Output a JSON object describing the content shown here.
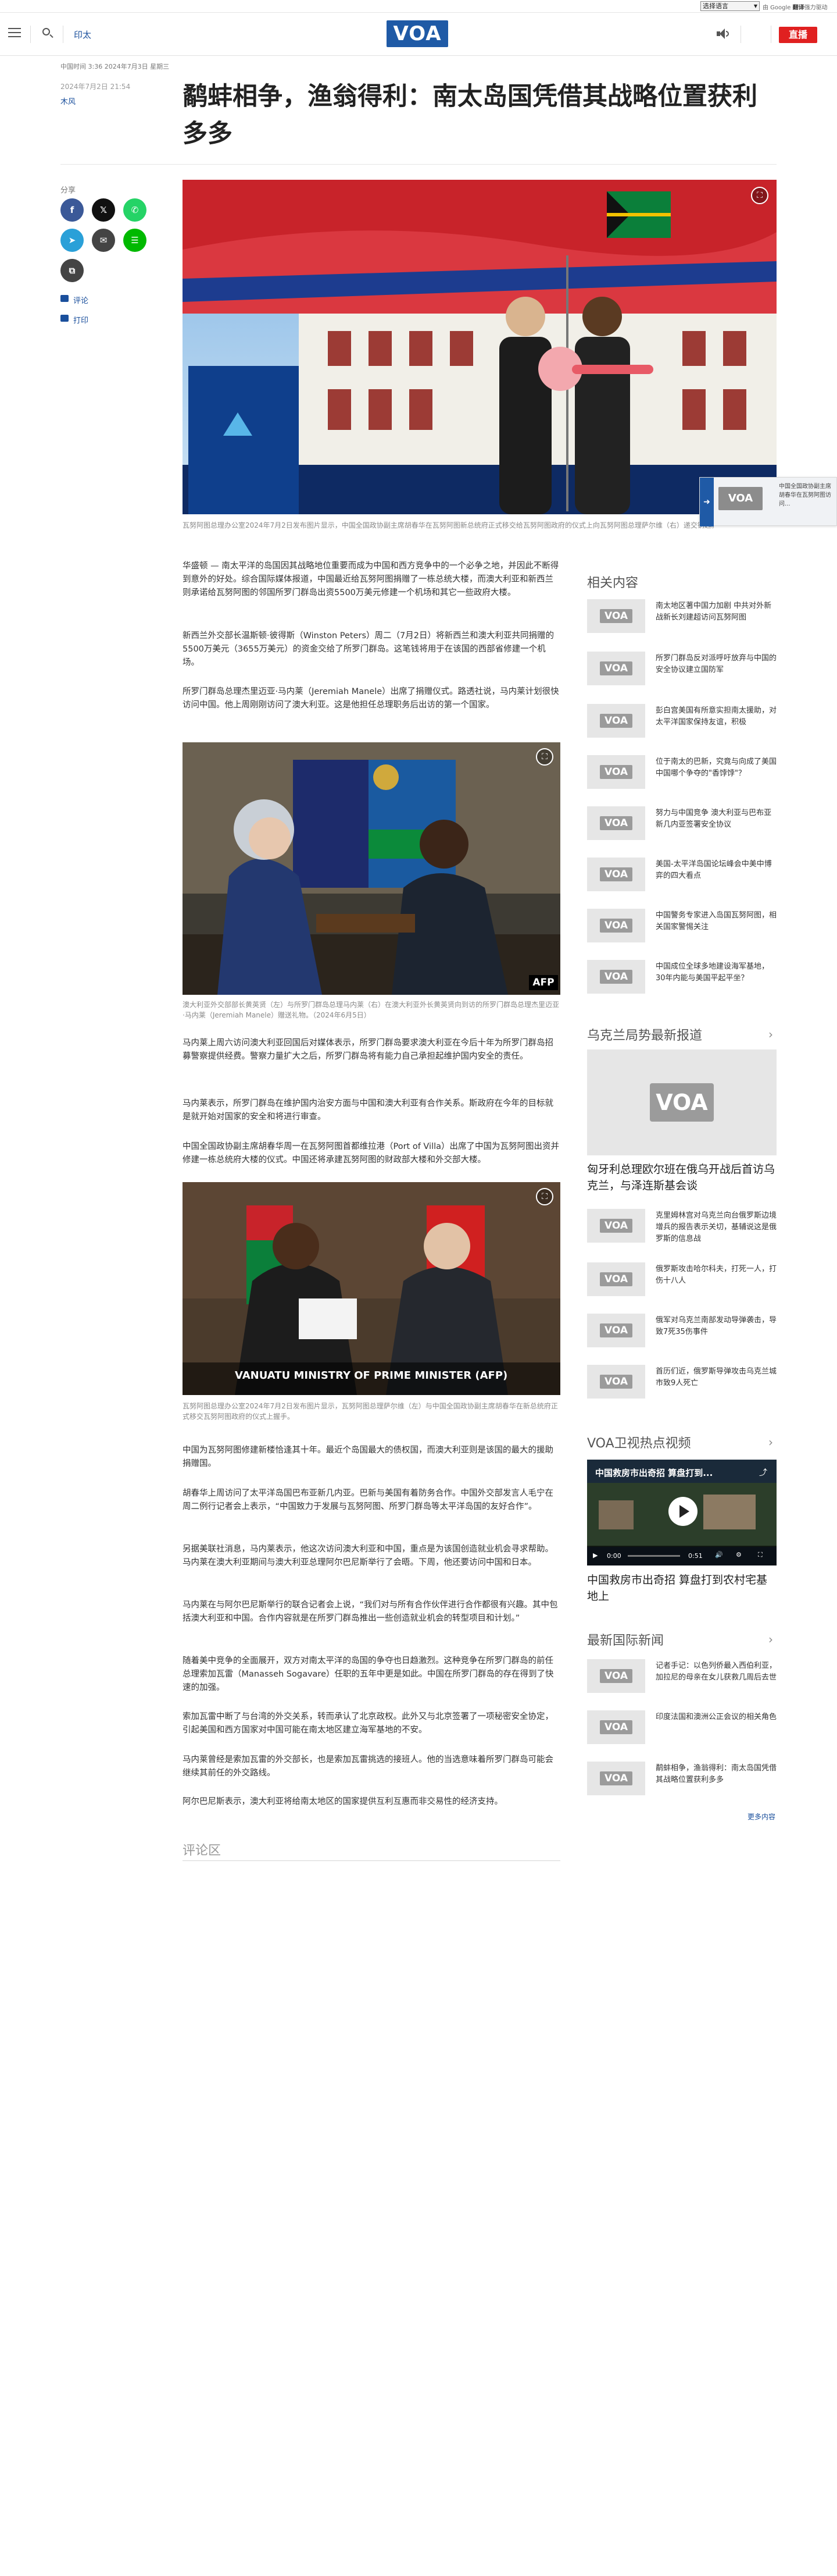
{
  "translate": {
    "select_label": "选择语言",
    "credit_prefix": "由 Google",
    "credit_brand": "翻译",
    "credit_suffix": "强力驱动"
  },
  "header": {
    "region": "印太",
    "logo_text": "VOA",
    "live_label": "直播"
  },
  "meta": {
    "timeline": "中国时间 3:36 2024年7月3日 星期三",
    "pubdate": "2024年7月2日 21:54",
    "author": "木风"
  },
  "article": {
    "title": "鹬蚌相争，渔翁得利：南太岛国凭借其战略位置获利多多",
    "share_label": "分享",
    "comments_link": "评论",
    "print_link": "打印",
    "hero_caption": "瓦努阿图总理办公室2024年7月2日发布图片显示，中国全国政协副主席胡春华在瓦努阿图新总统府正式移交给瓦努阿图政府的仪式上向瓦努阿图总理萨尔维（右）递交钥匙。",
    "paragraphs1": [
      "华盛顿 — 南太平洋的岛国因其战略地位重要而成为中国和西方竞争中的一个必争之地，并因此不断得到意外的好处。综合国际媒体报道，中国最近给瓦努阿图捐赠了一栋总统大楼，而澳大利亚和新西兰则承诺给瓦努阿图的邻国所罗门群岛出资5500万美元修建一个机场和其它一些政府大楼。",
      "新西兰外交部长温斯顿·彼得斯（Winston Peters）周二（7月2日）将新西兰和澳大利亚共同捐赠的5500万美元（3655万美元）的资金交给了所罗门群岛。这笔钱将用于在该国的西部省修建一个机场。",
      "所罗门群岛总理杰里迈亚·马内莱（Jeremiah Manele）出席了捐赠仪式。路透社说，马内莱计划很快访问中国。他上周刚刚访问了澳大利亚。这是他担任总理职务后出访的第一个国家。"
    ],
    "img2_caption": "澳大利亚外交部部长黄英贤（左）与所罗门群岛总理马内莱（右）在澳大利亚外长黄英贤向到访的所罗门群岛总理杰里迈亚·马内莱（Jeremiah Manele）赠送礼物。（2024年6月5日）",
    "img2_badge": "AFP",
    "paragraphs2": [
      "马内莱上周六访问澳大利亚回国后对媒体表示，所罗门群岛要求澳大利亚在今后十年为所罗门群岛招募警察提供经费。警察力量扩大之后，所罗门群岛将有能力自己承担起维护国内安全的责任。",
      "马内莱表示，所罗门群岛在维护国内治安方面与中国和澳大利亚有合作关系。斯政府在今年的目标就是就开始对国家的安全和将进行审查。",
      "中国全国政协副主席胡春华周一在瓦努阿图首都维拉港（Port of Villa）出席了中国为瓦努阿图出资并修建一栋总统府大楼的仪式。中国还将承建瓦努阿图的财政部大楼和外交部大楼。"
    ],
    "img3_caption": "瓦努阿图总理办公室2024年7月2日发布图片显示，瓦努阿图总理萨尔维（左）与中国全国政协副主席胡春华在新总统府正式移交瓦努阿图政府的仪式上握手。",
    "img3_banner": "VANUATU MINISTRY OF PRIME MINISTER (AFP)",
    "paragraphs3": [
      "中国为瓦努阿图修建新楼恰逢其十年。最近个岛国最大的债权国，而澳大利亚则是该国的最大的援助捐赠国。",
      "胡春华上周访问了太平洋岛国巴布亚新几内亚。巴新与美国有着防务合作。中国外交部发言人毛宁在周二例行记者会上表示，“中国致力于发展与瓦努阿图、所罗门群岛等太平洋岛国的友好合作”。",
      "另据美联社消息，马内莱表示，他这次访问澳大利亚和中国，重点是为该国创造就业机会寻求帮助。马内莱在澳大利亚期间与澳大利亚总理阿尔巴尼斯举行了会晤。下周，他还要访问中国和日本。",
      "马内莱在与阿尔巴尼斯举行的联合记者会上说，“我们对与所有合作伙伴进行合作都很有兴趣。其中包括澳大利亚和中国。合作内容就是在所罗门群岛推出一些创造就业机会的转型项目和计划。”",
      "随着美中竞争的全面展开，双方对南太平洋的岛国的争夺也日趋激烈。这种竞争在所罗门群岛的前任总理索加瓦雷（Manasseh Sogavare）任职的五年中更是如此。中国在所罗门群岛的存在得到了快速的加强。",
      "索加瓦雷中断了与台湾的外交关系，转而承认了北京政权。此外又与北京签署了一项秘密安全协定，引起美国和西方国家对中国可能在南太地区建立海军基地的不安。",
      "马内莱曾经是索加瓦雷的外交部长，也是索加瓦雷挑选的接班人。他的当选意味着所罗门群岛可能会继续其前任的外交路线。",
      "阿尔巴尼斯表示，澳大利亚将给南太地区的国家提供互利互惠而非交易性的经济支持。"
    ],
    "comments_heading": "评论区"
  },
  "sidebar": {
    "related_title": "相关内容",
    "related": [
      "南太地区著中国力加剧 中共对外新战新长刘建超访问瓦努阿图",
      "所罗门群岛反对派呼吁放弃与中国的安全协议建立国防军",
      "彭白宫美国有所意实担南太援助，对太平洋国家保持友谊，积极",
      "位于南太的巴新，究竟与向成了美国中国哪个争夺的\"香饽饽\"？",
      "努力与中国竞争 澳大利亚与巴布亚新几内亚签署安全协议",
      "美国-太平洋岛国论坛峰会中美中博弈的四大看点",
      "中国警务专家进入岛国瓦努阿图，相关国家警惕关注",
      "中国成位全球多地建设海军基地，30年内能与美国平起平坐？"
    ],
    "ukraine_title": "乌克兰局势最新报道",
    "ukraine_big": "匈牙利总理欧尔班在俄乌开战后首访乌克兰，与泽连斯基会谈",
    "ukraine": [
      "克里姆林宫对乌克兰向台俄罗斯边境增兵的报告表示关切，基辅说这是俄罗斯的信息战",
      "俄罗斯攻击哈尔科夫，打死一人，打伤十八人",
      "俄军对乌克兰南部发动导弹袭击，导致7死35伤事件",
      "首历们近，俄罗斯导弹攻击乌克兰城市致9人死亡"
    ],
    "video_title": "VOA卫视热点视频",
    "video_embed_title": "中国救房市出奇招 算盘打到...",
    "video_time": "0:00",
    "video_duration": "0:51",
    "video_caption": "中国救房市出奇招 算盘打到农村宅基地上",
    "intl_title": "最新国际新闻",
    "intl": [
      "记者手记：以色列侨最入西伯利亚，加拉尼的母亲在女儿获救几周后去世",
      "印度法国和澳洲公正会议的相关角色",
      "鹬蚌相争，渔翁得利：南太岛国凭借其战略位置获利多多"
    ],
    "more": "更多内容",
    "float_text": "中国全国政协副主席胡春华在瓦努阿图访问..."
  },
  "colors": {
    "brand": "#1f5aa6",
    "live": "#e02020",
    "facebook": "#3b5998",
    "x": "#111111",
    "whatsapp": "#25d366",
    "telegram": "#2aa0d8",
    "mail": "#444444",
    "line": "#00b900",
    "link": "#1a4f9c"
  }
}
